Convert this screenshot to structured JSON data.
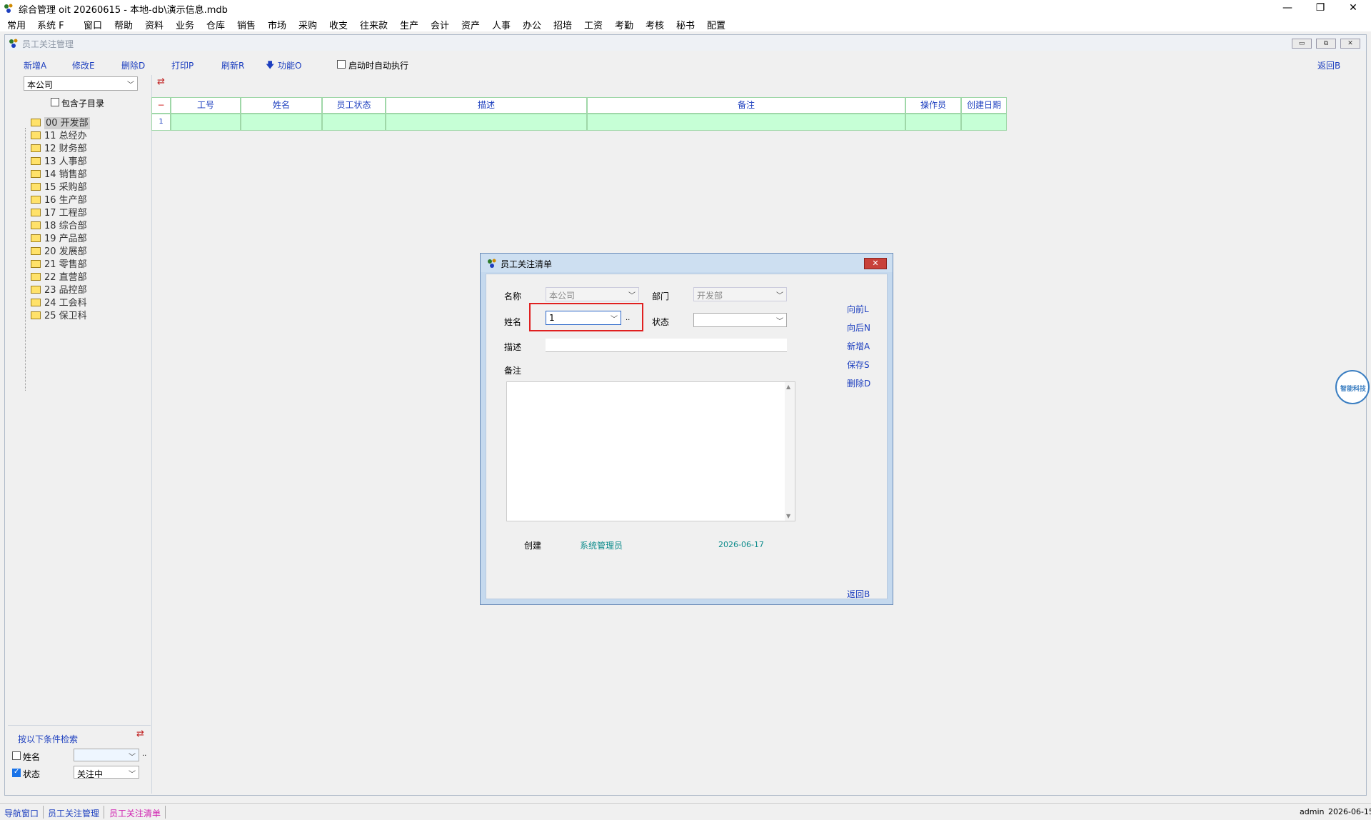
{
  "app": {
    "title": "综合管理 oit 20260615 - 本地-db\\演示信息.mdb",
    "minimize": "—",
    "restore": "❐",
    "close": "✕"
  },
  "menu": [
    "常用",
    "系统 F",
    "窗口",
    "帮助",
    "资料",
    "业务",
    "仓库",
    "销售",
    "市场",
    "采购",
    "收支",
    "往来款",
    "生产",
    "会计",
    "资产",
    "人事",
    "办公",
    "招培",
    "工资",
    "考勤",
    "考核",
    "秘书",
    "配置"
  ],
  "child": {
    "title": "员工关注管理",
    "controls": [
      "▭",
      "⧉",
      "✕"
    ],
    "toolbar": {
      "new": "新增A",
      "edit": "修改E",
      "delete": "删除D",
      "print": "打印P",
      "refresh": "刷新R",
      "function": "功能O",
      "autorun_label": "启动时自动执行",
      "back": "返回B"
    },
    "company_select": "本公司",
    "include_sub_label": "包含子目录",
    "tree": [
      {
        "label": "00 开发部",
        "selected": true
      },
      {
        "label": "11 总经办"
      },
      {
        "label": "12 财务部"
      },
      {
        "label": "13 人事部"
      },
      {
        "label": "14 销售部"
      },
      {
        "label": "15 采购部"
      },
      {
        "label": "16 生产部"
      },
      {
        "label": "17 工程部"
      },
      {
        "label": "18 综合部"
      },
      {
        "label": "19 产品部"
      },
      {
        "label": "20 发展部"
      },
      {
        "label": "21 零售部"
      },
      {
        "label": "22 直营部"
      },
      {
        "label": "23 品控部"
      },
      {
        "label": "24 工会科"
      },
      {
        "label": "25 保卫科"
      }
    ],
    "grid": {
      "corner": "−",
      "columns": [
        "工号",
        "姓名",
        "员工状态",
        "描述",
        "备注",
        "操作员",
        "创建日期"
      ],
      "rows": [
        {
          "num": "1"
        }
      ]
    },
    "search": {
      "title": "按以下条件检索",
      "name_label": "姓名",
      "name_value": "",
      "dots": "..",
      "status_label": "状态",
      "status_value": "关注中",
      "name_checked": false,
      "status_checked": true
    }
  },
  "dialog": {
    "title": "员工关注清单",
    "close": "✕",
    "name_label": "名称",
    "name_value": "本公司",
    "dept_label": "部门",
    "dept_value": "开发部",
    "person_label": "姓名",
    "person_value": "1",
    "dots": "..",
    "status_label": "状态",
    "status_value": "",
    "desc_label": "描述",
    "desc_value": "",
    "remark_label": "备注",
    "remark_value": "",
    "created_label": "创建",
    "created_by": "系统管理员",
    "created_date": "2026-06-17",
    "actions": {
      "prev": "向前L",
      "next": "向后N",
      "new": "新增A",
      "save": "保存S",
      "delete": "删除D",
      "back": "返回B"
    }
  },
  "badge": "智能科技",
  "statusbar": {
    "tabs": [
      "导航窗口",
      "员工关注管理",
      "员工关注清单"
    ],
    "user": "admin",
    "date": "2026-06-15"
  },
  "colors": {
    "link": "#1d3fbf",
    "grid_row": "#c6ffd6",
    "highlight_box": "#e02020",
    "active_tab": "#d020b0"
  }
}
